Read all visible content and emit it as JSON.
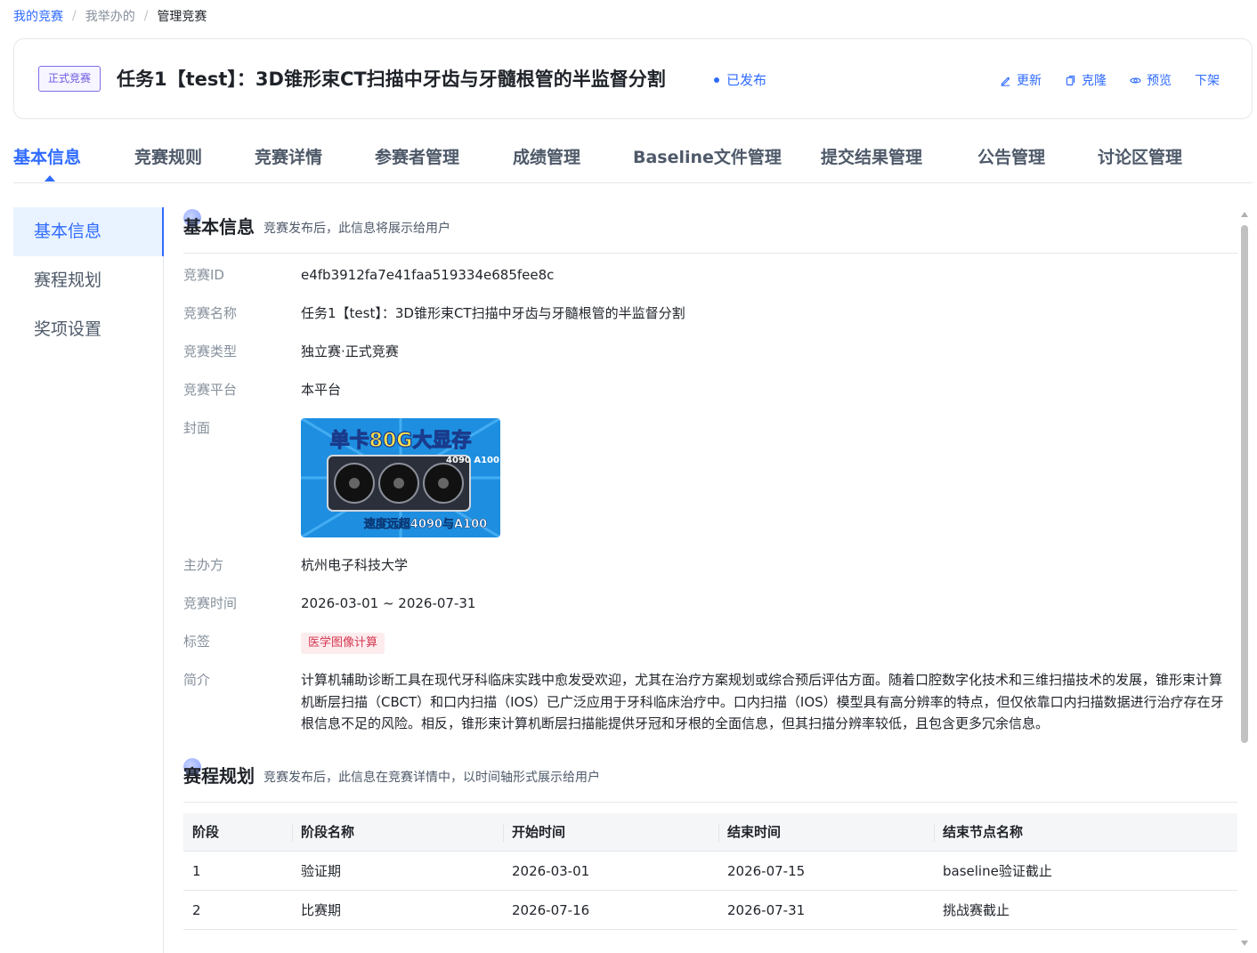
{
  "breadcrumb": {
    "root": "我的竞赛",
    "mid": "我举办的",
    "current": "管理竞赛",
    "separator": "/"
  },
  "header": {
    "type_tag": "正式竞赛",
    "title": "任务1【test】：3D锥形束CT扫描中牙齿与牙髓根管的半监督分割",
    "status": "已发布",
    "actions": {
      "update": "更新",
      "clone": "克隆",
      "preview": "预览",
      "unpublish": "下架"
    }
  },
  "tabs": [
    "基本信息",
    "竞赛规则",
    "竞赛详情",
    "参赛者管理",
    "成绩管理",
    "Baseline文件管理",
    "提交结果管理",
    "公告管理",
    "讨论区管理"
  ],
  "active_tab": 0,
  "sidenav": [
    "基本信息",
    "赛程规划",
    "奖项设置"
  ],
  "basic": {
    "title": "基本信息",
    "desc": "竞赛发布后，此信息将展示给用户",
    "labels": {
      "id": "竞赛ID",
      "name": "竞赛名称",
      "type": "竞赛类型",
      "platform": "竞赛平台",
      "cover": "封面",
      "organizer": "主办方",
      "time": "竞赛时间",
      "tags": "标签",
      "intro": "简介"
    },
    "values": {
      "id": "e4fb3912fa7e41faa519334e685fee8c",
      "name": "任务1【test】：3D锥形束CT扫描中牙齿与牙髓根管的半监督分割",
      "type": "独立赛·正式竞赛",
      "platform": "本平台",
      "organizer": "杭州电子科技大学",
      "time": "2026-03-01 ~ 2026-07-31",
      "tag": "医学图像计算",
      "intro": "计算机辅助诊断工具在现代牙科临床实践中愈发受欢迎，尤其在治疗方案规划或综合预后评估方面。随着口腔数字化技术和三维扫描技术的发展，锥形束计算机断层扫描（CBCT）和口内扫描（IOS）已广泛应用于牙科临床治疗中。口内扫描（IOS）模型具有高分辨率的特点，但仅依靠口内扫描数据进行治疗存在牙根信息不足的风险。相反，锥形束计算机断层扫描能提供牙冠和牙根的全面信息，但其扫描分辨率较低，且包含更多冗余信息。"
    },
    "cover_image": {
      "headline": "单卡80G大显存",
      "badge": "4090 A100",
      "footer": "速度远超4090与A100",
      "colors": {
        "bg": "#1e8fe0",
        "headline": "#ffe14d",
        "card": "#2a2f3a"
      }
    }
  },
  "schedule": {
    "title": "赛程规划",
    "desc": "竞赛发布后，此信息在竞赛详情中，以时间轴形式展示给用户",
    "columns": [
      "阶段",
      "阶段名称",
      "开始时间",
      "结束时间",
      "结束节点名称"
    ],
    "rows": [
      [
        "1",
        "验证期",
        "2026-03-01",
        "2026-07-15",
        "baseline验证截止"
      ],
      [
        "2",
        "比赛期",
        "2026-07-16",
        "2026-07-31",
        "挑战赛截止"
      ]
    ]
  },
  "colors": {
    "accent": "#2f6bff",
    "tag_red": "#d4364f",
    "type_tag": "#6a5ae0"
  }
}
